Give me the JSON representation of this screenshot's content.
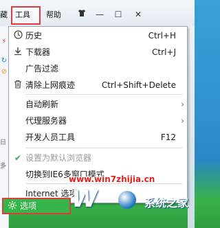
{
  "menubar": {
    "partial_left": "藏",
    "tools_label": "工具",
    "help_label": "帮助"
  },
  "window_buttons": [
    "—",
    "☐",
    "✕"
  ],
  "menu": {
    "items": [
      {
        "icon": "clock-icon",
        "label": "历史",
        "shortcut": "Ctrl+H"
      },
      {
        "icon": "download-icon",
        "label": "下载器",
        "shortcut": "Ctrl+J"
      },
      {
        "icon": "",
        "label": "广告过滤",
        "shortcut": ""
      },
      {
        "icon": "trash-icon",
        "label": "清除上网痕迹",
        "shortcut": "Ctrl+Shift+Delete"
      },
      {
        "icon": "",
        "label": "自动刷新",
        "shortcut": ""
      },
      {
        "icon": "",
        "label": "代理服务器",
        "shortcut": ""
      },
      {
        "icon": "",
        "label": "开发人员工具",
        "shortcut": "F12"
      },
      {
        "icon": "check-icon",
        "label": "设置为默认浏览器",
        "shortcut": ""
      },
      {
        "icon": "",
        "label": "切换到IE6多窗口模式",
        "shortcut": ""
      },
      {
        "icon": "",
        "label": "Internet 选项",
        "shortcut": ""
      }
    ],
    "options_label": "选项"
  },
  "sidebar": {
    "partial_text_1": "日",
    "partial_text_2": "多"
  },
  "watermark": {
    "url": "www.win7zhijia.cn",
    "logo_text": "系统之家"
  },
  "colors": {
    "highlight_border": "#e23b3b",
    "options_bg": "#36b64a",
    "check": "#3aa64a"
  }
}
